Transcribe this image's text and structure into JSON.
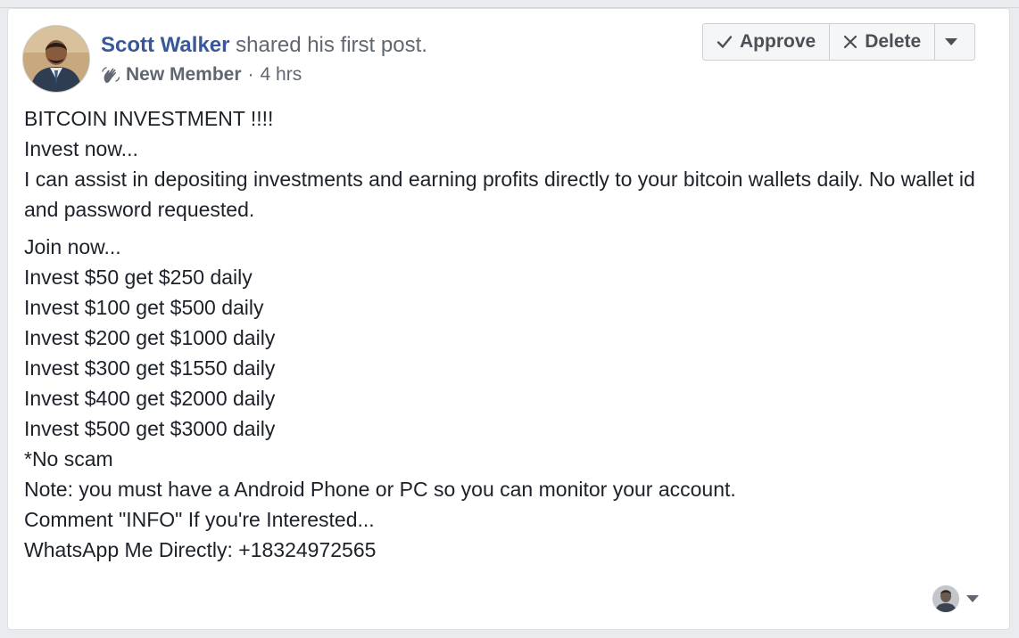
{
  "post": {
    "author": "Scott Walker",
    "action": " shared his first post.",
    "badge": "New Member",
    "separator": "·",
    "time": "4 hrs"
  },
  "actions": {
    "approve": "Approve",
    "delete": "Delete"
  },
  "body": {
    "paragraph1": [
      "BITCOIN INVESTMENT !!!!",
      "Invest now...",
      "I can assist in depositing investments and earning profits directly to your bitcoin wallets daily. No wallet id and password requested."
    ],
    "paragraph2": [
      "Join now...",
      "Invest $50 get $250 daily",
      "Invest $100 get $500 daily",
      "Invest $200 get $1000 daily",
      "Invest $300 get $1550 daily",
      "Invest $400 get $2000 daily",
      "Invest $500 get $3000 daily",
      "*No scam",
      "Note: you must have a Android Phone or PC so you can monitor your account.",
      "Comment \"INFO\" If you're Interested...",
      "WhatsApp Me Directly: +18324972565"
    ]
  },
  "icons": {
    "badge": "waving-hand-icon",
    "approve": "checkmark-icon",
    "delete": "x-icon",
    "more": "caret-down-icon",
    "viewer": "caret-down-icon"
  },
  "colors": {
    "author": "#385898",
    "meta": "#606770",
    "body_text": "#1d2129",
    "button_bg": "#f5f6f7",
    "button_border": "#ccd0d5"
  }
}
